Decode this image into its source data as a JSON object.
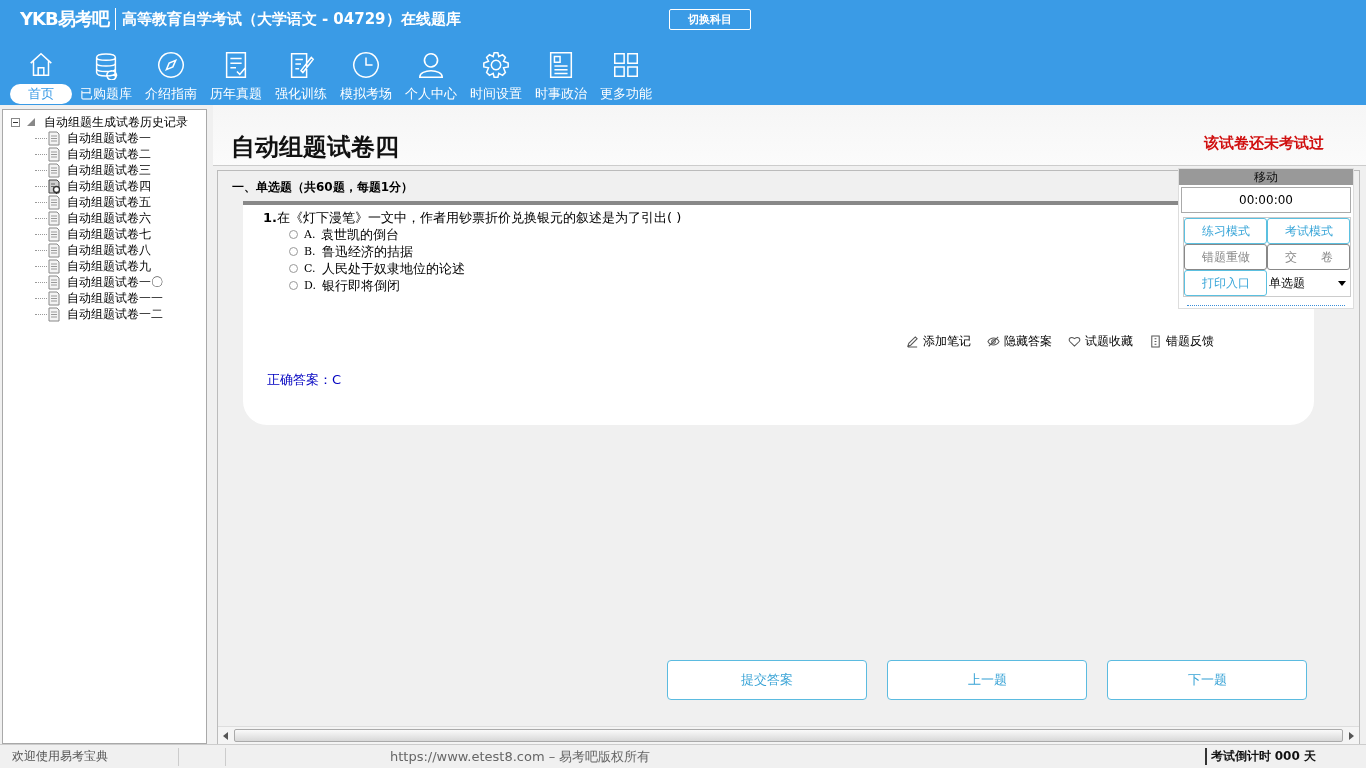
{
  "header": {
    "logo": "YKB易考吧",
    "title": "高等教育自学考试（大学语文 - 04729）在线题库",
    "switch_button": "切换科目"
  },
  "nav": [
    {
      "label": "首页",
      "selected": true
    },
    {
      "label": "已购题库",
      "selected": false
    },
    {
      "label": "介绍指南",
      "selected": false
    },
    {
      "label": "历年真题",
      "selected": false
    },
    {
      "label": "强化训练",
      "selected": false
    },
    {
      "label": "模拟考场",
      "selected": false
    },
    {
      "label": "个人中心",
      "selected": false
    },
    {
      "label": "时间设置",
      "selected": false
    },
    {
      "label": "时事政治",
      "selected": false
    },
    {
      "label": "更多功能",
      "selected": false
    }
  ],
  "tree": {
    "label": "自动组题生成试卷历史记录",
    "expanded": true,
    "children": [
      {
        "label": "自动组题试卷一",
        "selected": false
      },
      {
        "label": "自动组题试卷二",
        "selected": false
      },
      {
        "label": "自动组题试卷三",
        "selected": false
      },
      {
        "label": "自动组题试卷四",
        "selected": true
      },
      {
        "label": "自动组题试卷五",
        "selected": false
      },
      {
        "label": "自动组题试卷六",
        "selected": false
      },
      {
        "label": "自动组题试卷七",
        "selected": false
      },
      {
        "label": "自动组题试卷八",
        "selected": false
      },
      {
        "label": "自动组题试卷九",
        "selected": false
      },
      {
        "label": "自动组题试卷一〇",
        "selected": false
      },
      {
        "label": "自动组题试卷一一",
        "selected": false
      },
      {
        "label": "自动组题试卷一二",
        "selected": false
      }
    ]
  },
  "paper": {
    "title": "自动组题试卷四",
    "status": "该试卷还未考试过"
  },
  "section": "一、单选题（共60题，每题1分）",
  "question": {
    "number": "1.",
    "stem": "在《灯下漫笔》一文中，作者用钞票折价兑换银元的叙述是为了引出( )",
    "options": [
      {
        "letter": "A.",
        "text": "袁世凯的倒台",
        "selected": false
      },
      {
        "letter": "B.",
        "text": "鲁迅经济的拮据",
        "selected": false
      },
      {
        "letter": "C.",
        "text": "人民处于奴隶地位的论述",
        "selected": false
      },
      {
        "letter": "D.",
        "text": "银行即将倒闭",
        "selected": false
      }
    ],
    "actions": [
      "添加笔记",
      "隐藏答案",
      "试题收藏",
      "错题反馈"
    ],
    "answer_label": "正确答案：",
    "answer": "C"
  },
  "control_panel": {
    "handle": "移动",
    "timer": "00:00:00",
    "buttons": [
      {
        "label": "练习模式",
        "disabled": false
      },
      {
        "label": "考试模式",
        "disabled": false
      },
      {
        "label": "错题重做",
        "disabled": true
      },
      {
        "label": "交　　卷",
        "disabled": true
      },
      {
        "label": "打印入口",
        "disabled": false
      }
    ],
    "type_select": "单选题"
  },
  "bottom_buttons": [
    "提交答案",
    "上一题",
    "下一题"
  ],
  "status_bar": {
    "welcome": "欢迎使用易考宝典",
    "copyright": "https://www.etest8.com – 易考吧版权所有",
    "countdown": "考试倒计时 000 天"
  }
}
